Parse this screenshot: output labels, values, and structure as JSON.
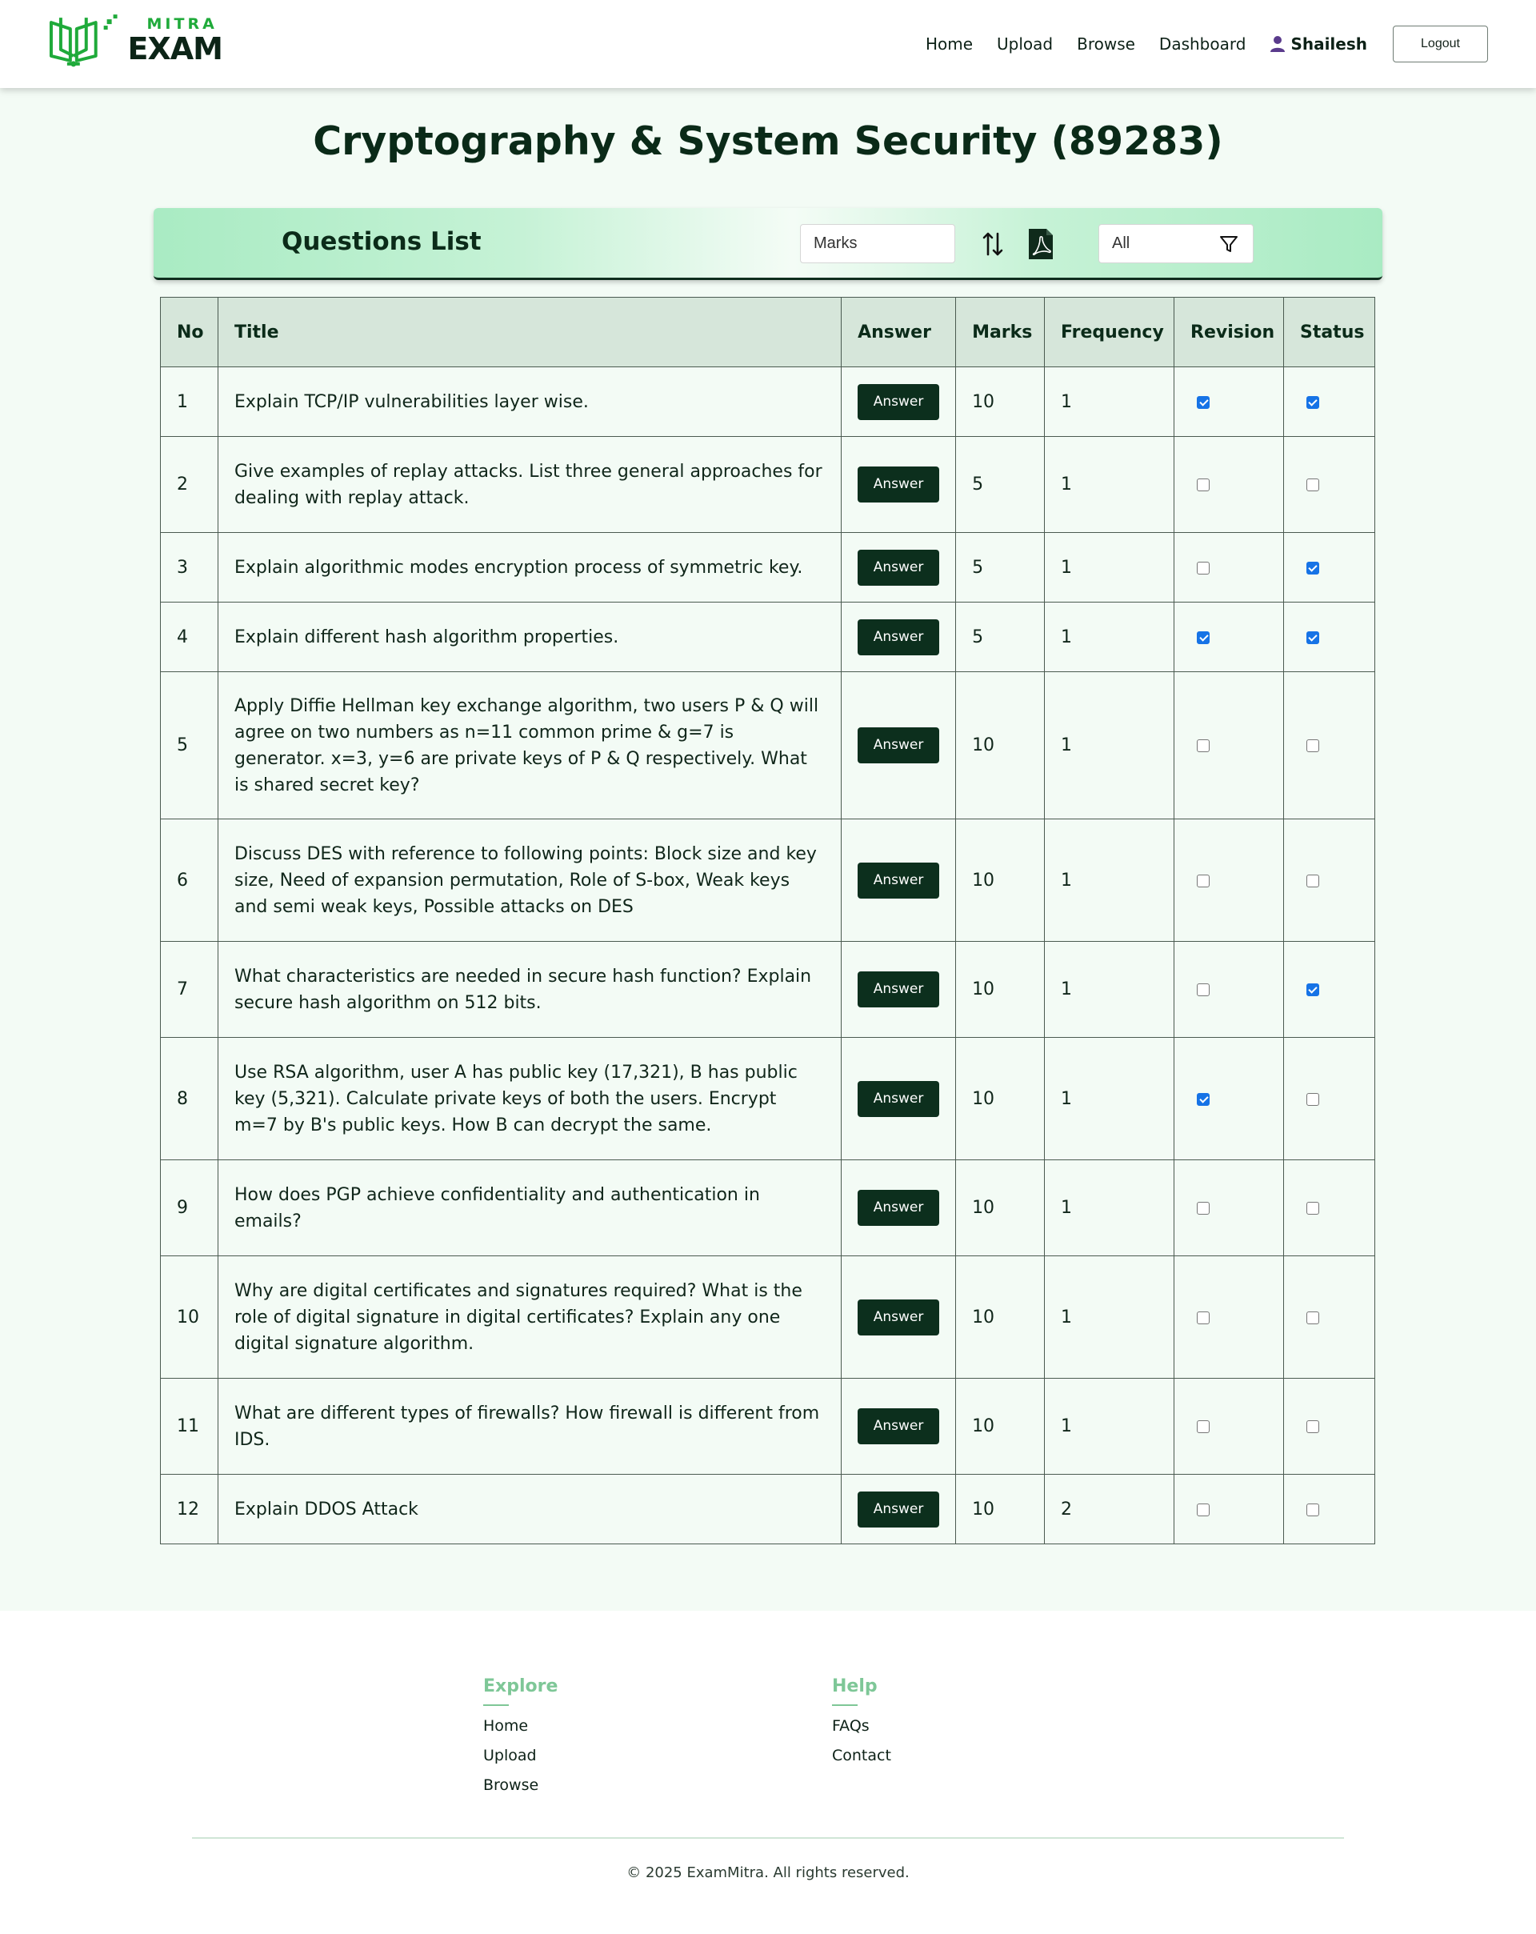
{
  "brand": {
    "mitra": "MITRA",
    "exam": "EXAM"
  },
  "nav": {
    "links": [
      "Home",
      "Upload",
      "Browse",
      "Dashboard"
    ],
    "user": "Shailesh",
    "logout": "Logout"
  },
  "page_title": "Cryptography & System Security (89283)",
  "questions_bar": {
    "title": "Questions List",
    "sort_value": "Marks",
    "filter_value": "All"
  },
  "table": {
    "headers": [
      "No",
      "Title",
      "Answer",
      "Marks",
      "Frequency",
      "Revision",
      "Status"
    ],
    "answer_label": "Answer",
    "rows": [
      {
        "no": "1",
        "title": "Explain TCP/IP vulnerabilities layer wise.",
        "marks": "10",
        "frequency": "1",
        "revision": true,
        "status": true
      },
      {
        "no": "2",
        "title": "Give examples of replay attacks. List three general approaches for dealing with replay attack.",
        "marks": "5",
        "frequency": "1",
        "revision": false,
        "status": false
      },
      {
        "no": "3",
        "title": "Explain algorithmic modes encryption process of symmetric key.",
        "marks": "5",
        "frequency": "1",
        "revision": false,
        "status": true
      },
      {
        "no": "4",
        "title": "Explain different hash algorithm properties.",
        "marks": "5",
        "frequency": "1",
        "revision": true,
        "status": true
      },
      {
        "no": "5",
        "title": "Apply Diffie Hellman key exchange algorithm, two users P & Q will agree on two numbers as n=11 common prime & g=7 is generator. x=3, y=6 are private keys of P & Q respectively. What is shared secret key?",
        "marks": "10",
        "frequency": "1",
        "revision": false,
        "status": false
      },
      {
        "no": "6",
        "title": "Discuss DES with reference to following points: Block size and key size, Need of expansion permutation, Role of S-box, Weak keys and semi weak keys, Possible attacks on DES",
        "marks": "10",
        "frequency": "1",
        "revision": false,
        "status": false
      },
      {
        "no": "7",
        "title": "What characteristics are needed in secure hash function? Explain secure hash algorithm on 512 bits.",
        "marks": "10",
        "frequency": "1",
        "revision": false,
        "status": true
      },
      {
        "no": "8",
        "title": "Use RSA algorithm, user A has public key (17,321), B has public key (5,321). Calculate private keys of both the users. Encrypt m=7 by B's public keys. How B can decrypt the same.",
        "marks": "10",
        "frequency": "1",
        "revision": true,
        "status": false
      },
      {
        "no": "9",
        "title": "How does PGP achieve confidentiality and authentication in emails?",
        "marks": "10",
        "frequency": "1",
        "revision": false,
        "status": false
      },
      {
        "no": "10",
        "title": "Why are digital certificates and signatures required? What is the role of digital signature in digital certificates? Explain any one digital signature algorithm.",
        "marks": "10",
        "frequency": "1",
        "revision": false,
        "status": false
      },
      {
        "no": "11",
        "title": "What are different types of firewalls? How firewall is different from IDS.",
        "marks": "10",
        "frequency": "1",
        "revision": false,
        "status": false
      },
      {
        "no": "12",
        "title": "Explain DDOS Attack",
        "marks": "10",
        "frequency": "2",
        "revision": false,
        "status": false
      }
    ]
  },
  "footer": {
    "explore_title": "Explore",
    "explore_links": [
      "Home",
      "Upload",
      "Browse"
    ],
    "help_title": "Help",
    "help_links": [
      "FAQs",
      "Contact"
    ],
    "copyright": "© 2025 ExamMitra. All rights reserved."
  },
  "colors": {
    "brand_green": "#1faa3a",
    "dark_green": "#0c2f1d",
    "checkbox_blue": "#1673e6",
    "footer_accent": "#7ec797"
  },
  "icons": [
    "book-logo-icon",
    "user-icon",
    "sort-arrows-icon",
    "pdf-icon",
    "filter-icon"
  ]
}
